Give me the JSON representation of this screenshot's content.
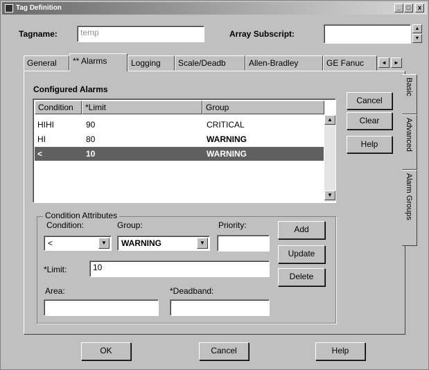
{
  "window": {
    "title": "Tag Definition",
    "minimize": "_",
    "maximize": "□",
    "close": "x"
  },
  "top": {
    "tagname_label": "Tagname:",
    "tagname_value": "temp",
    "array_label": "Array Subscript:",
    "array_value": "",
    "spin_up": "▲",
    "spin_down": "▼"
  },
  "tabs": [
    {
      "label": "General"
    },
    {
      "label": "** Alarms"
    },
    {
      "label": "Logging"
    },
    {
      "label": "Scale/Deadb"
    },
    {
      "label": "Allen-Bradley"
    },
    {
      "label": "GE Fanuc"
    }
  ],
  "tab_scroll": {
    "left": "◄",
    "right": "►"
  },
  "side_tabs": [
    {
      "label": "Basic"
    },
    {
      "label": "Advanced"
    },
    {
      "label": "Alarm Groups"
    }
  ],
  "alarms": {
    "caption": "Configured Alarms",
    "columns": [
      "Condition",
      "*Limit",
      "Group"
    ],
    "rows": [
      {
        "condition": "HIHI",
        "limit": "90",
        "group": "CRITICAL"
      },
      {
        "condition": "HI",
        "limit": "80",
        "group": "WARNING"
      },
      {
        "condition": "<",
        "limit": "10",
        "group": "WARNING"
      }
    ],
    "selected_row": 2
  },
  "side_buttons": {
    "cancel": "Cancel",
    "clear": "Clear",
    "help": "Help"
  },
  "attributes": {
    "caption": "Condition Attributes",
    "condition_label": "Condition:",
    "condition_value": "<",
    "group_label": "Group:",
    "group_value": "WARNING",
    "priority_label": "Priority:",
    "priority_value": "",
    "limit_label": "*Limit:",
    "limit_value": "10",
    "area_label": "Area:",
    "area_value": "",
    "deadband_label": "*Deadband:",
    "deadband_value": "",
    "add": "Add",
    "update": "Update",
    "delete": "Delete"
  },
  "footer": {
    "ok": "OK",
    "cancel": "Cancel",
    "help": "Help"
  }
}
